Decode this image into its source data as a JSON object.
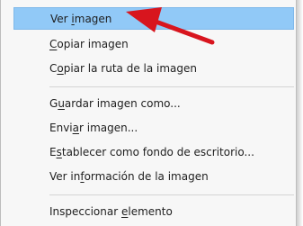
{
  "menu": {
    "items": [
      {
        "pre": "Ver ",
        "key": "i",
        "post": "magen"
      },
      {
        "pre": "",
        "key": "C",
        "post": "opiar imagen"
      },
      {
        "pre": "C",
        "key": "o",
        "post": "piar la ruta de la imagen"
      },
      {
        "pre": "G",
        "key": "u",
        "post": "ardar imagen como..."
      },
      {
        "pre": "Envi",
        "key": "a",
        "post": "r imagen..."
      },
      {
        "pre": "E",
        "key": "s",
        "post": "tablecer como fondo de escritorio..."
      },
      {
        "pre": "Ver in",
        "key": "f",
        "post": "ormación de la imagen"
      },
      {
        "pre": "Inspeccionar ",
        "key": "e",
        "post": "lemento"
      }
    ]
  },
  "colors": {
    "highlight": "#91c9f7",
    "arrow": "#d8151e"
  },
  "icons": {
    "annotation": "red-arrow-icon"
  }
}
